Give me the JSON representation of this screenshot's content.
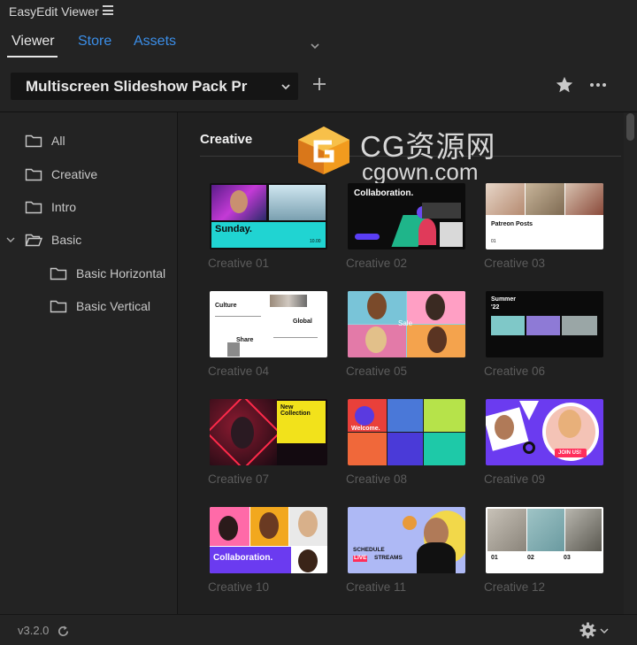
{
  "app": {
    "title": "EasyEdit Viewer",
    "version": "v3.2.0"
  },
  "tabs": [
    {
      "label": "Viewer",
      "active": true
    },
    {
      "label": "Store",
      "active": false
    },
    {
      "label": "Assets",
      "active": false
    }
  ],
  "pack_select": {
    "value": "Multiscreen Slideshow Pack Pr"
  },
  "sidebar": {
    "items": [
      {
        "label": "All"
      },
      {
        "label": "Creative"
      },
      {
        "label": "Intro"
      },
      {
        "label": "Basic",
        "expanded": true
      },
      {
        "label": "Basic Horizontal"
      },
      {
        "label": "Basic Vertical"
      }
    ]
  },
  "watermark": {
    "cn": "CG资源网",
    "en": "cgown.com"
  },
  "section": {
    "title": "Creative"
  },
  "grid": {
    "items": [
      {
        "label": "Creative 01",
        "texts": [
          "Sunday.",
          "10.00"
        ]
      },
      {
        "label": "Creative 02",
        "texts": [
          "Collaboration."
        ]
      },
      {
        "label": "Creative 03",
        "texts": [
          "Patreon Posts",
          "01"
        ]
      },
      {
        "label": "Creative 04",
        "texts": [
          "Culture",
          "Global",
          "Share"
        ]
      },
      {
        "label": "Creative 05",
        "texts": [
          "Sale"
        ]
      },
      {
        "label": "Creative 06",
        "texts": [
          "Summer",
          "'22"
        ]
      },
      {
        "label": "Creative 07",
        "texts": [
          "New Collection"
        ]
      },
      {
        "label": "Creative 08",
        "texts": [
          "Welcome."
        ]
      },
      {
        "label": "Creative 09",
        "texts": [
          "JOIN US!"
        ]
      },
      {
        "label": "Creative 10",
        "texts": [
          "Collaboration."
        ]
      },
      {
        "label": "Creative 11",
        "texts": [
          "SCHEDULE",
          "LIVE",
          "STREAMS"
        ]
      },
      {
        "label": "Creative 12",
        "texts": [
          "01",
          "02",
          "03"
        ]
      }
    ]
  },
  "colors": {
    "accent": "#3b8ee8",
    "panel": "#232323",
    "content": "#202020",
    "cyan": "#1fd6d6",
    "purple": "#6b3bf0",
    "yellow": "#f2e21b"
  }
}
